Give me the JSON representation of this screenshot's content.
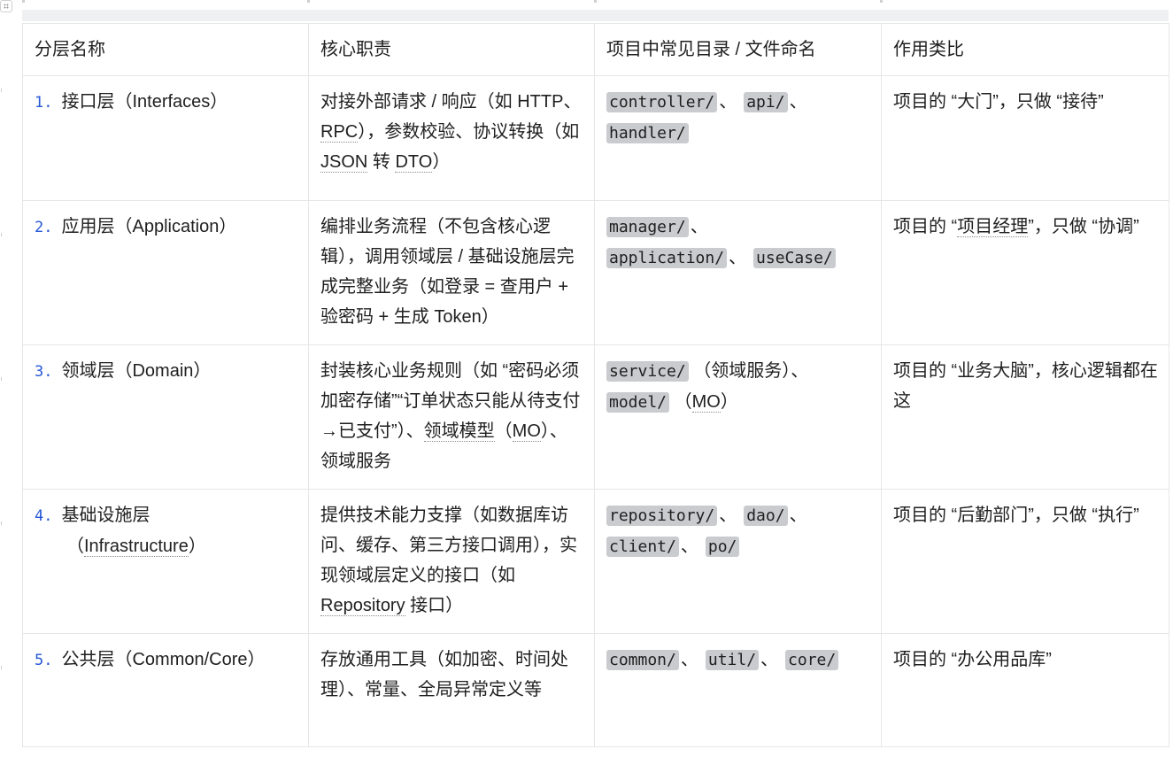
{
  "headers": [
    "分层名称",
    "核心职责",
    "项目中常见目录 / 文件命名",
    "作用类比"
  ],
  "rows": [
    {
      "num": "1.",
      "name": "接口层（Interfaces）",
      "duty_a": "对接外部请求 / 响应（如 ",
      "duty_b": "HTTP、",
      "duty_c": "RPC",
      "duty_d": "），参数校验、协议转换（如 ",
      "duty_e": "JSON",
      "duty_f": " 转 ",
      "duty_g": "DTO",
      "duty_h": "）",
      "dirs": [
        "controller/",
        "api/",
        "handler/"
      ],
      "analogy": "项目的 “大门”，只做 “接待”"
    },
    {
      "num": "2.",
      "name": "应用层（Application）",
      "duty": "编排业务流程（不包含核心逻辑），调用领域层 / 基础设施层完成完整业务（如登录 = 查用户 + 验密码 + 生成 Token）",
      "dirs": [
        "manager/",
        "application/",
        "useCase/"
      ],
      "analogy_a": "项目的 “",
      "analogy_b": "项目经理",
      "analogy_c": "”，只做 “协调”"
    },
    {
      "num": "3.",
      "name": "领域层（Domain）",
      "duty_a": "封装核心业务规则（如 “密码必须加密存储”“订单状态只能从待支付→已支付”）、",
      "duty_b": "领域模型",
      "duty_c": "（",
      "duty_d": "MO",
      "duty_e": "）、领域服务",
      "dirs": [
        "service/",
        "model/"
      ],
      "dir_notes": [
        "（领域服务）、",
        "（",
        "MO",
        "）"
      ],
      "analogy": "项目的 “业务大脑”，核心逻辑都在这"
    },
    {
      "num": "4.",
      "name_a": "基础设施层",
      "name_b": "（",
      "name_c": "Infrastructure",
      "name_d": "）",
      "duty_a": "提供技术能力支撑（如数据库访问、缓存、第三方接口调用），实现领域层定义的接口（如 ",
      "duty_b": "Repository",
      "duty_c": " 接口）",
      "dirs": [
        "repository/",
        "dao/",
        "client/",
        "po/"
      ],
      "analogy": "项目的 “后勤部门”，只做 “执行”"
    },
    {
      "num": "5.",
      "name": "公共层（Common/Core）",
      "duty": "存放通用工具（如加密、时间处理）、常量、全局异常定义等",
      "dirs": [
        "common/",
        "util/",
        "core/"
      ],
      "analogy": "项目的 “办公用品库”"
    }
  ],
  "separator": "、"
}
